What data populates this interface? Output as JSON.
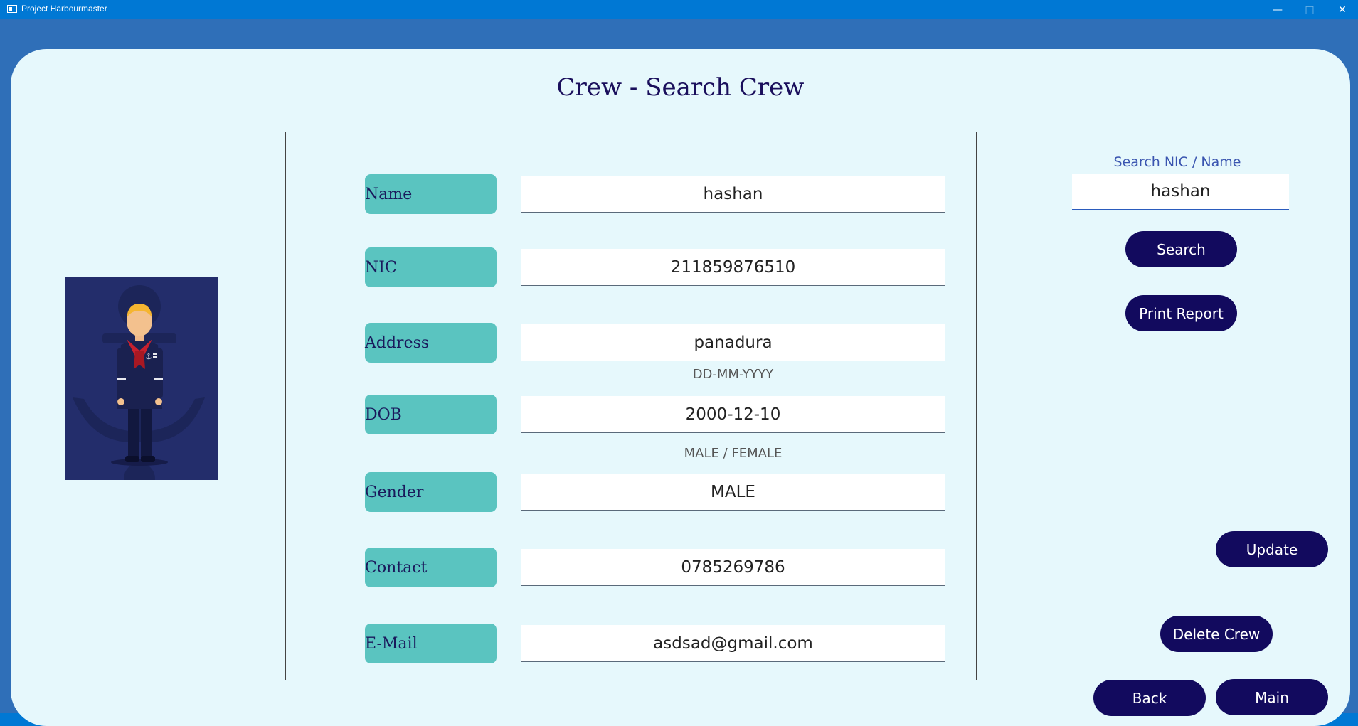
{
  "window": {
    "title": "Project Harbourmaster"
  },
  "page": {
    "title": "Crew - Search Crew"
  },
  "form": {
    "fields": [
      {
        "label": "Name",
        "value": "hashan",
        "hint": ""
      },
      {
        "label": "NIC",
        "value": "211859876510",
        "hint": ""
      },
      {
        "label": "Address",
        "value": "panadura",
        "hint": ""
      },
      {
        "label": "DOB",
        "value": "2000-12-10",
        "hint": "DD-MM-YYYY"
      },
      {
        "label": "Gender",
        "value": "MALE",
        "hint": "MALE / FEMALE"
      },
      {
        "label": "Contact",
        "value": "0785269786",
        "hint": ""
      },
      {
        "label": "E-Mail",
        "value": "asdsad@gmail.com",
        "hint": ""
      }
    ]
  },
  "search": {
    "label": "Search NIC / Name",
    "value": "hashan",
    "button": "Search",
    "print_button": "Print Report"
  },
  "actions": {
    "update": "Update",
    "delete": "Delete Crew",
    "back": "Back",
    "main": "Main"
  },
  "colors": {
    "accent": "#120a5e",
    "label_bg": "#5ac4c0",
    "panel_bg": "#e6f8fc",
    "titlebar": "#0078d4"
  }
}
